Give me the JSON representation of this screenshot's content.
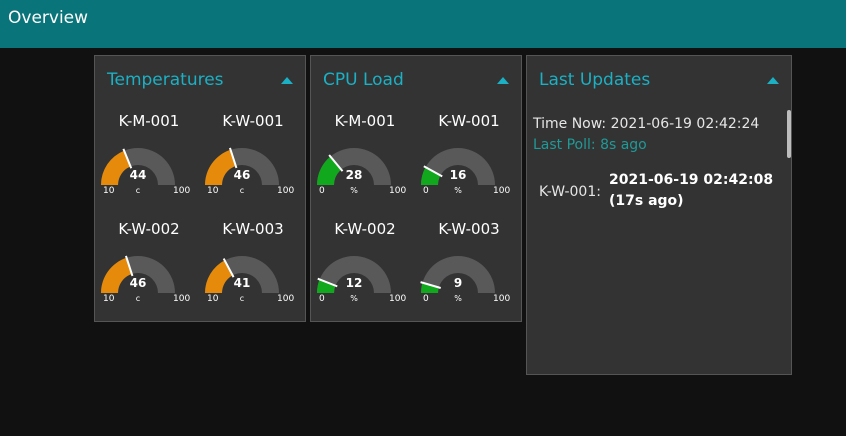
{
  "app": {
    "title": "Overview"
  },
  "colors": {
    "header": "#097479",
    "accent": "#1bb0c4",
    "temp_fill": "#e58a0a",
    "cpu_fill": "#12a81d",
    "track": "#595959"
  },
  "panels": {
    "temperatures": {
      "title": "Temperatures",
      "gauges": [
        {
          "name": "K-M-001",
          "value": 44,
          "value_label": "44",
          "unit": "c",
          "min": 10,
          "min_label": "10",
          "max": 100,
          "max_label": "100"
        },
        {
          "name": "K-W-001",
          "value": 46,
          "value_label": "46",
          "unit": "c",
          "min": 10,
          "min_label": "10",
          "max": 100,
          "max_label": "100"
        },
        {
          "name": "K-W-002",
          "value": 46,
          "value_label": "46",
          "unit": "c",
          "min": 10,
          "min_label": "10",
          "max": 100,
          "max_label": "100"
        },
        {
          "name": "K-W-003",
          "value": 41,
          "value_label": "41",
          "unit": "c",
          "min": 10,
          "min_label": "10",
          "max": 100,
          "max_label": "100"
        }
      ]
    },
    "cpu": {
      "title": "CPU Load",
      "gauges": [
        {
          "name": "K-M-001",
          "value": 28,
          "value_label": "28",
          "unit": "%",
          "min": 0,
          "min_label": "0",
          "max": 100,
          "max_label": "100"
        },
        {
          "name": "K-W-001",
          "value": 16,
          "value_label": "16",
          "unit": "%",
          "min": 0,
          "min_label": "0",
          "max": 100,
          "max_label": "100"
        },
        {
          "name": "K-W-002",
          "value": 12,
          "value_label": "12",
          "unit": "%",
          "min": 0,
          "min_label": "0",
          "max": 100,
          "max_label": "100"
        },
        {
          "name": "K-W-003",
          "value": 9,
          "value_label": "9",
          "unit": "%",
          "min": 0,
          "min_label": "0",
          "max": 100,
          "max_label": "100"
        }
      ]
    },
    "updates": {
      "title": "Last Updates",
      "time_now": "Time Now: 2021-06-19 02:42:24",
      "last_poll": "Last Poll: 8s ago",
      "rows": [
        {
          "name": "K-W-001:",
          "line1": "2021-06-19 02:42:08",
          "line2": "(17s ago)"
        }
      ]
    }
  }
}
